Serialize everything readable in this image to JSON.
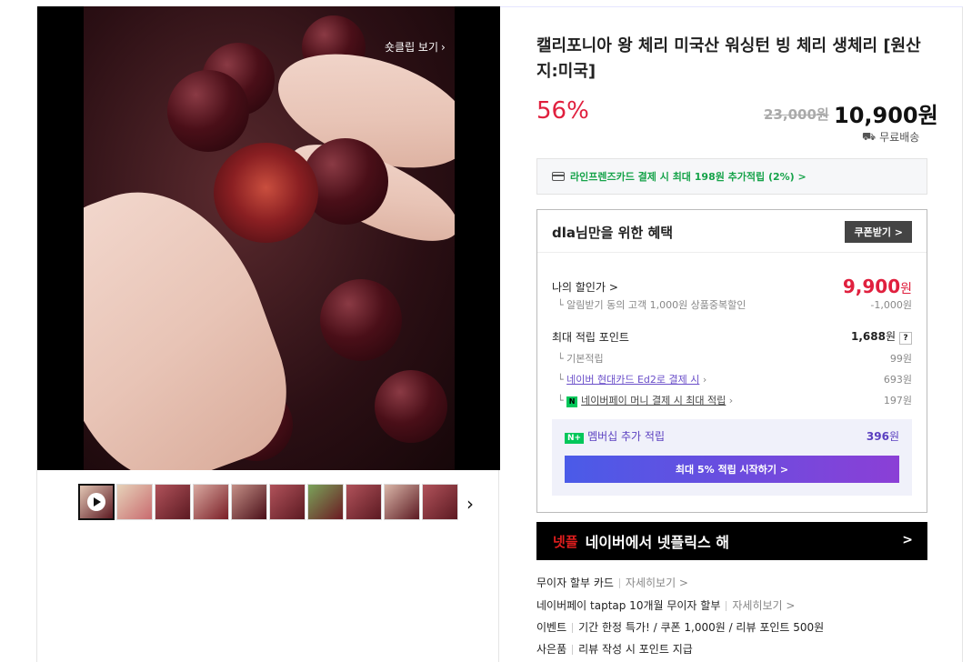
{
  "media": {
    "shortclip_label": "숏클립 보기",
    "thumb_count": 10
  },
  "product": {
    "title": "캘리포니아 왕 체리 미국산 워싱턴 빙 체리 생체리 [원산지:미국]",
    "discount": "56%",
    "original_price": "23,000원",
    "sale_price": "10,900원",
    "shipping": "무료배송",
    "card_promo": "라인프렌즈카드 결제 시 최대 198원 추가적립 (2%) >"
  },
  "benefit": {
    "title_user": "dla",
    "title_rest": "님만을 위한 혜택",
    "coupon_button": "쿠폰받기 >",
    "my_price_label": "나의 할인가 >",
    "my_price_value": "9,900",
    "my_price_unit": "원",
    "alarm_label": "알림받기 동의 고객 1,000원 상품중복할인",
    "alarm_value": "-1,000원",
    "max_points_label": "최대 적립 포인트",
    "max_points_value": "1,688",
    "max_points_unit": "원",
    "question_mark": "?",
    "basic_label": "기본적립",
    "basic_value": "99원",
    "hyundai_label": "네이버 현대카드 Ed2로 결제 시",
    "hyundai_value": "693원",
    "npay_badge": "N",
    "npay_label": "네이버페이 머니 결제 시 최대 적립",
    "npay_value": "197원",
    "membership_badge": "N+",
    "membership_label": "멤버십 추가 적립",
    "membership_value": "396",
    "membership_unit": "원",
    "membership_button": "최대 5% 적립 시작하기 >"
  },
  "netflix_banner": {
    "logo": "넷플",
    "text": "네이버에서 넷플릭스 해",
    "arrow": ">"
  },
  "info_rows": [
    {
      "label": "무이자 할부 카드",
      "value": "자세히보기 >"
    },
    {
      "label": "네이버페이 taptap 10개월 무이자 할부",
      "value": "자세히보기 >"
    },
    {
      "label": "이벤트",
      "value": "기간 한정 특가! / 쿠폰 1,000원 / 리뷰 포인트 500원"
    },
    {
      "label": "사은품",
      "value": "리뷰 작성 시 포인트 지급"
    }
  ],
  "colors": {
    "discount_red": "#e0203e",
    "npay_green": "#03c75a",
    "purple": "#6a4ec9"
  }
}
